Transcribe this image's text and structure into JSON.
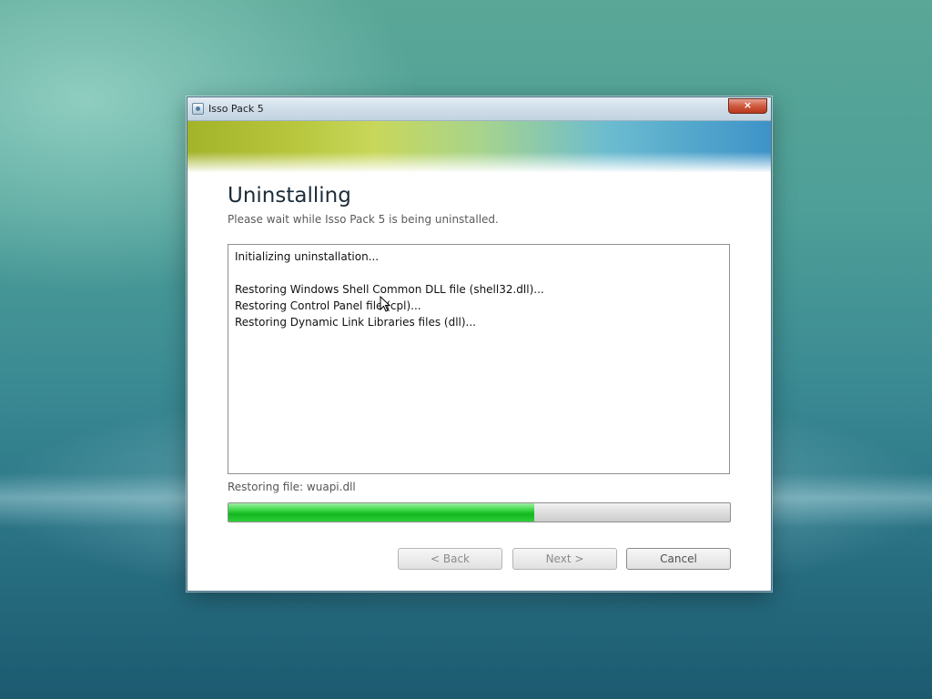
{
  "window": {
    "title": "Isso Pack 5",
    "close_glyph": "×"
  },
  "header": {
    "title": "Uninstalling",
    "subtitle": "Please wait while Isso Pack 5 is being uninstalled."
  },
  "log": {
    "lines": [
      "Initializing uninstallation...",
      "",
      "Restoring Windows Shell Common DLL file (shell32.dll)...",
      "Restoring Control Panel file (cpl)...",
      "Restoring Dynamic Link Libraries files (dll)..."
    ]
  },
  "status": {
    "text": "Restoring file: wuapi.dll"
  },
  "progress": {
    "fraction": 0.61,
    "color": "#1cc12a"
  },
  "buttons": {
    "back": "< Back",
    "next": "Next >",
    "cancel": "Cancel"
  },
  "icons": {
    "app": "installer-icon",
    "close": "close-icon",
    "cursor": "mouse-pointer-icon"
  }
}
